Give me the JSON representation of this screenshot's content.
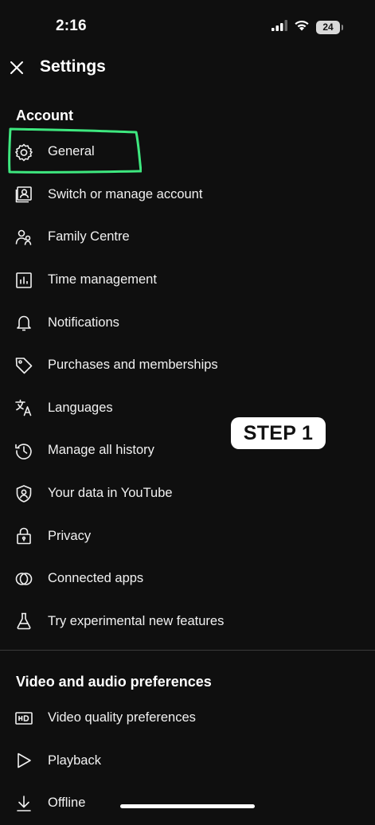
{
  "status_bar": {
    "time": "2:16",
    "battery_level": "24"
  },
  "header": {
    "title": "Settings"
  },
  "sections": {
    "account": {
      "title": "Account",
      "items": [
        {
          "label": "General",
          "icon": "gear-icon"
        },
        {
          "label": "Switch or manage account",
          "icon": "account-switch-icon"
        },
        {
          "label": "Family Centre",
          "icon": "family-icon"
        },
        {
          "label": "Time management",
          "icon": "bar-chart-icon"
        },
        {
          "label": "Notifications",
          "icon": "bell-icon"
        },
        {
          "label": "Purchases and memberships",
          "icon": "tag-icon"
        },
        {
          "label": "Languages",
          "icon": "translate-icon"
        },
        {
          "label": "Manage all history",
          "icon": "history-icon"
        },
        {
          "label": "Your data in YouTube",
          "icon": "shield-user-icon"
        },
        {
          "label": "Privacy",
          "icon": "lock-icon"
        },
        {
          "label": "Connected apps",
          "icon": "connected-apps-icon"
        },
        {
          "label": "Try experimental new features",
          "icon": "flask-icon"
        }
      ]
    },
    "video_audio": {
      "title": "Video and audio preferences",
      "items": [
        {
          "label": "Video quality preferences",
          "icon": "hd-icon"
        },
        {
          "label": "Playback",
          "icon": "play-icon"
        },
        {
          "label": "Offline",
          "icon": "download-icon"
        }
      ]
    }
  },
  "annotation": {
    "step_label": "STEP 1",
    "highlight_color": "#3ee87f"
  },
  "colors": {
    "background": "#0f0f0f",
    "text": "#f1f1f1"
  }
}
